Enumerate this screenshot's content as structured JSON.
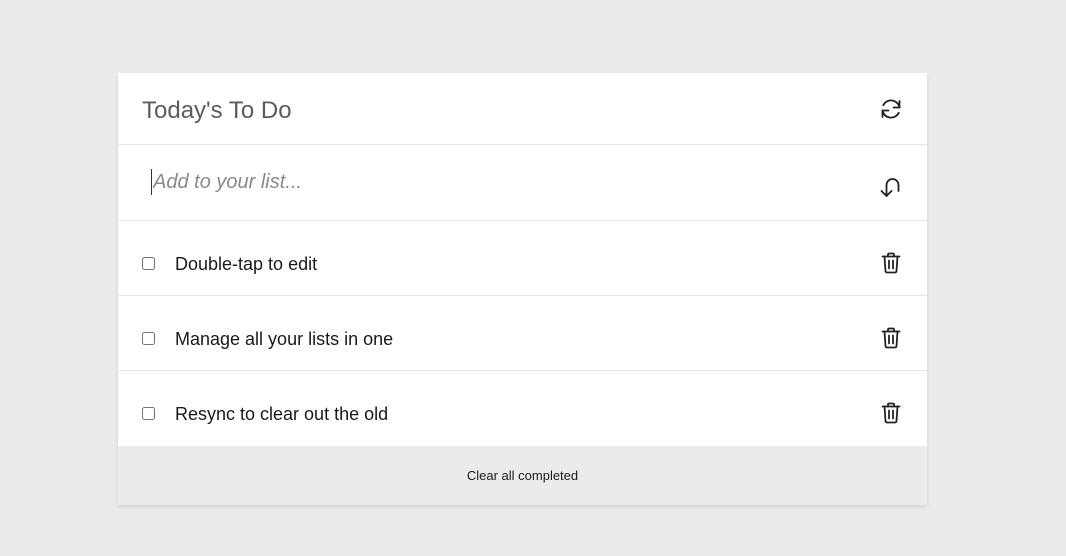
{
  "app": {
    "title": "Today's To Do"
  },
  "header": {
    "refresh_icon": "refresh-icon"
  },
  "add": {
    "placeholder": "Add to your list...",
    "value": "",
    "submit_icon": "return-arrow-icon"
  },
  "todos": [
    {
      "text": "Double-tap to edit",
      "completed": false
    },
    {
      "text": "Manage all your lists in one",
      "completed": false
    },
    {
      "text": "Resync to clear out the old",
      "completed": false
    }
  ],
  "footer": {
    "clear_label": "Clear all completed"
  },
  "colors": {
    "page_background": "#ebebeb",
    "card_background": "#ffffff",
    "title_text": "#5c5c5c",
    "divider": "#e6e6e6"
  }
}
